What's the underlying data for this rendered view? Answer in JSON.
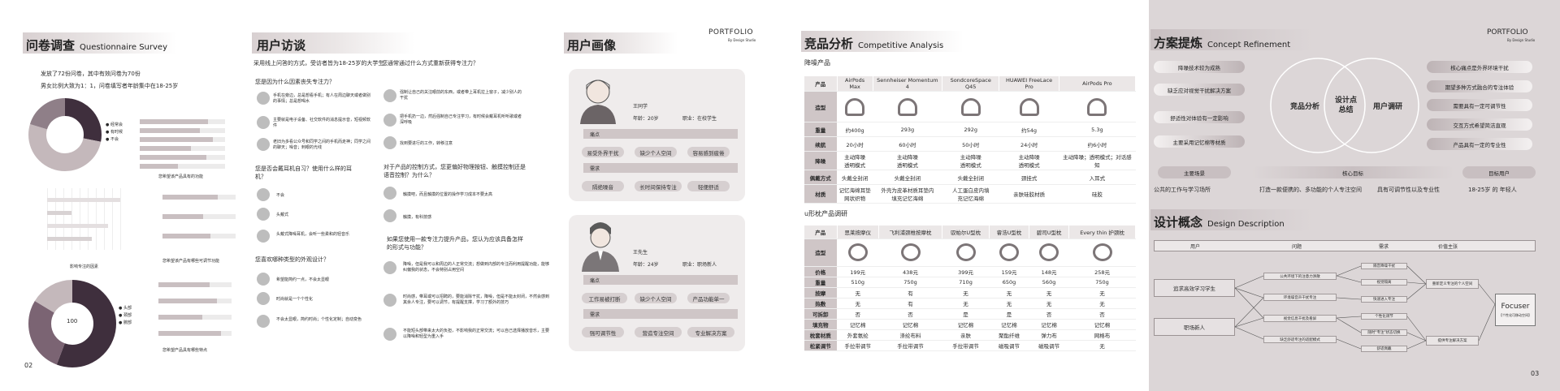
{
  "survey": {
    "title": "问卷调查",
    "title_en": "Questionnaire Survey",
    "line1": "发放了72份问卷，其中有效问卷为70份",
    "line2": "男女比例大致为1：1，问卷填写者年龄集中在18-25岁",
    "legend1": [
      "经常会",
      "有时候",
      "不会"
    ],
    "legend2": [
      "头部",
      "颈部",
      "腕部"
    ],
    "donut_center": "100",
    "chart_labels": [
      "您希望该产品具有的功能",
      "影响专注的因素",
      "您希望该产品有哪些可调节功能",
      "您希望产品具有哪些特点"
    ],
    "page_num": "02"
  },
  "interview": {
    "title": "用户访谈",
    "intro": "采用线上问答的方式，受访者皆为18-25岁的大学生",
    "q1": "您是因为什么因素丧失专注力？",
    "a1": [
      "手机在旁边，总是想看手机；有人在周边聊天或者做别的事情；总是想喝水",
      "主要就是电子设备、社交软件的消息提示音，短视频软件",
      "老旧为多看公众号和同学之间的手机而走神；同学之间的聊天；噪音；刺眼的光线"
    ],
    "q2": "您是否会戴耳机自习？使用什么样的耳机？",
    "a2": [
      "不会",
      "头戴式",
      "头戴式降噪耳机，会听一些柔和的轻音乐"
    ],
    "q3": "您喜欢哪种类型的外观设计？",
    "a3": [
      "希望能简约一点，不会太显眼",
      "时尚就是一个个性化",
      "不会太显眼，简约时尚；个性化定制；自动变色"
    ],
    "q4": "您通常通过什么方式重新获得专注力？",
    "a4": [
      "强制让自己的关注眼前的东西，或者带上耳机拉上窗子，减少别人的干扰",
      "把手机扔一边，然后强制自己专注学习，有时候会戴耳机听听歌或者深呼吸",
      "找到要进行的工作，转移注意"
    ],
    "q5": "对于产品的控制方式，您更偏好物理按钮、触摸控制还是语音控制？为什么？",
    "a5": [
      "触摸吧，而且触摸的位置的操作学习成本不要太高",
      "触摸，有科技感"
    ],
    "q6": "如果您使用一款专注力提升产品，您认为应该具备怎样的形式与功能？",
    "a6": [
      "降噪，但是我可以和周边的人正常交流；想做到内部的专注而利用提醒功能，能够纠偏我的状态，不会特别占用空间",
      "时尚感，带耳或可以招聘的，要能消除干扰，降噪，但是不能太封闭，不然会感到其余人专注，要可以调节，有提醒支撑，学习了额外的技巧",
      "不能短头部带来太大的负担，不影响我的正常交流；可以自己选择播放音乐，主要以降噪和轻型为重入手"
    ]
  },
  "persona": {
    "title": "用户画像",
    "brand": "PORTFOLIO",
    "brand_sub": "By Design Studio",
    "p1": {
      "name": "王同学",
      "age": "年龄：20岁",
      "job": "职业：在校学生",
      "pain_label": "痛点",
      "pains": [
        "易受外界干扰",
        "缺少个人空间",
        "容易感到疲倦"
      ],
      "need_label": "需求",
      "needs": [
        "隔绝噪音",
        "长时间保持专注",
        "轻便舒适"
      ]
    },
    "p2": {
      "name": "王先生",
      "age": "年龄：24岁",
      "job": "职业：职场新人",
      "pain_label": "痛点",
      "pains": [
        "工作易被打断",
        "缺少个人空间",
        "产品功能单一"
      ],
      "need_label": "需求",
      "needs": [
        "强可调节性",
        "营造专注空间",
        "专业解决方案"
      ]
    }
  },
  "competitive": {
    "title": "竞品分析",
    "title_en": "Competitive Analysis",
    "sub1": "降噪产品",
    "table1": {
      "header": [
        "产品",
        "AirPods Max",
        "Sennheiser Momentum 4",
        "SondcoreSpace Q45",
        "HUAWEI FreeLace Pro",
        "AirPods Pro"
      ],
      "rows": [
        [
          "造型",
          "",
          "",
          "",
          "",
          ""
        ],
        [
          "重量",
          "约400g",
          "293g",
          "292g",
          "约54g",
          "5.3g"
        ],
        [
          "续航",
          "20小时",
          "60小时",
          "50小时",
          "24小时",
          "约6小时"
        ],
        [
          "降噪",
          "主动降噪\n透明模式",
          "主动降噪\n透明模式",
          "主动降噪\n透明模式",
          "主动降噪\n透明模式",
          "主动降噪；透明模式；对话感知"
        ],
        [
          "佩戴方式",
          "头戴全封闭",
          "头戴全封闭",
          "头戴全封闭",
          "颈挂式",
          "入耳式"
        ],
        [
          "材质",
          "记忆海绵耳垫\n网状织物",
          "外壳为皮革材质耳垫内\n填充记忆海绵",
          "人工蛋白皮内填\n充记忆海绵",
          "亲肤硅胶材质",
          "硅胶"
        ]
      ]
    },
    "sub2": "u形枕产品调研",
    "table2": {
      "header": [
        "产品",
        "思莱按摩仪",
        "飞利浦颈椎按摩枕",
        "驭帕尔U型枕",
        "睿浩U型枕",
        "碧司U型枕",
        "Every thin 护颈枕"
      ],
      "rows": [
        [
          "造型",
          "",
          "",
          "",
          "",
          "",
          ""
        ],
        [
          "价格",
          "199元",
          "438元",
          "399元",
          "159元",
          "148元",
          "258元"
        ],
        [
          "重量",
          "510g",
          "750g",
          "710g",
          "650g",
          "560g",
          "750g"
        ],
        [
          "按摩",
          "无",
          "有",
          "无",
          "无",
          "无",
          "无"
        ],
        [
          "热敷",
          "无",
          "有",
          "无",
          "无",
          "无",
          "无"
        ],
        [
          "可拆卸",
          "否",
          "否",
          "是",
          "是",
          "否",
          "否"
        ],
        [
          "填充物",
          "记忆棉",
          "记忆棉",
          "记忆棉",
          "记忆棉",
          "记忆棉",
          "记忆棉"
        ],
        [
          "枕套材质",
          "外套氨纶",
          "涤纶布料",
          "亲肤",
          "聚酯纤维",
          "弹力布",
          "网格布"
        ],
        [
          "松紧调节",
          "手拉带调节",
          "手拉带调节",
          "手拉带调节",
          "磁吸调节",
          "磁吸调节",
          "无"
        ]
      ]
    }
  },
  "concept": {
    "title": "方案提炼",
    "title_en": "Concept Refinement",
    "brand": "PORTFOLIO",
    "brand_sub": "By Design Studio",
    "left_items": [
      "降噪技术较为成熟",
      "缺乏应对视觉干扰解决方案",
      "舒适性对体验有一定影响",
      "主要采用记忆棉等材质"
    ],
    "right_items": [
      "核心痛点是外界环境干扰",
      "期望多种方式融合的专注体验",
      "需要具有一定可调节性",
      "交互方式希望简洁直观",
      "产品具有一定的专业性"
    ],
    "venn_left": "竞品分析",
    "venn_center": "设计点\n总结",
    "venn_right": "用户调研",
    "scene_label": "主要场景",
    "goal_label": "核心目标",
    "user_label": "目标用户",
    "scene": "公共的工作与学习场所",
    "goal": "打造一款便携的、多功能的个人专注空间",
    "goal2": "具有可调节性以及专业性",
    "users": "18-25岁 的 年轻人"
  },
  "design": {
    "title": "设计概念",
    "title_en": "Design Description",
    "headers": [
      "用户",
      "问题",
      "需求",
      "价值主张"
    ],
    "users": [
      "追求高效学习学生",
      "职场新人"
    ],
    "problems": [
      "公共环境下的注意力涣散",
      "环境噪音声干扰专注",
      "视觉信息干扰及看屏",
      "缺乏舒适专注的适配模式"
    ],
    "needs": [
      "隔音降噪干扰",
      "视觉隔离",
      "快速进入专注",
      "个性化调节",
      "随时\"专注\"状态切换",
      "舒适佩戴"
    ],
    "values": [
      "重新定义专注的个人空间",
      "提供专注解决方案"
    ],
    "final": "Focuser",
    "final_sub": "【个性化可移动空间】",
    "page_num": "03"
  }
}
